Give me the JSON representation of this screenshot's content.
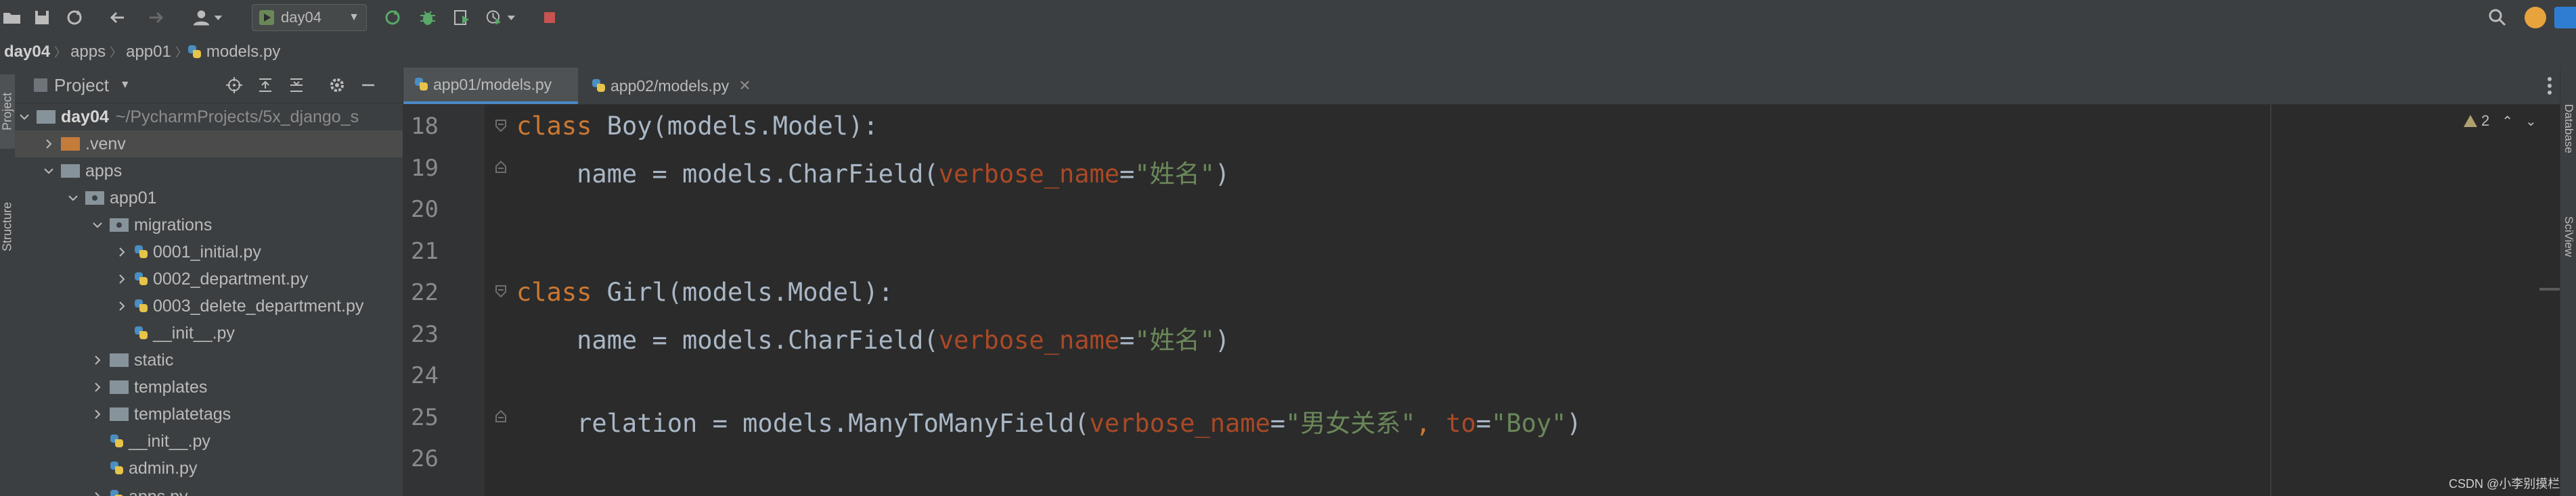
{
  "toolbar": {
    "run_config_label": "day04"
  },
  "breadcrumb": {
    "items": [
      "day04",
      "apps",
      "app01",
      "models.py"
    ]
  },
  "left_strip": {
    "project_tab": "Project",
    "structure_tab": "Structure"
  },
  "right_strip": {
    "database_tab": "Database",
    "sciview_tab": "SciView"
  },
  "project_panel": {
    "title": "Project",
    "tree": {
      "root_name": "day04",
      "root_path": "~/PycharmProjects/5x_django_s",
      "venv": ".venv",
      "apps": "apps",
      "app01": "app01",
      "migrations": "migrations",
      "m1": "0001_initial.py",
      "m2": "0002_department.py",
      "m3": "0003_delete_department.py",
      "m_init": "__init__.py",
      "static": "static",
      "templates": "templates",
      "templatetags": "templatetags",
      "app_init": "__init__.py",
      "admin": "admin.py",
      "apps_py": "apps.py"
    }
  },
  "editor_tabs": [
    {
      "label": "app01/models.py",
      "active": true
    },
    {
      "label": "app02/models.py",
      "active": false
    }
  ],
  "editor": {
    "line_numbers": [
      "18",
      "19",
      "20",
      "21",
      "22",
      "23",
      "24",
      "25",
      "26"
    ],
    "code": {
      "l18_kw": "class",
      "l18_rest": " Boy(models.Model):",
      "l19_a": "    name = models.CharField(",
      "l19_param": "verbose_name",
      "l19_eq": "=",
      "l19_str": "\"姓名\"",
      "l19_close": ")",
      "l22_kw": "class",
      "l22_rest": " Girl(models.Model):",
      "l23_a": "    name = models.CharField(",
      "l23_param": "verbose_name",
      "l23_eq": "=",
      "l23_str": "\"姓名\"",
      "l23_close": ")",
      "l25_a": "    relation = models.ManyToManyField(",
      "l25_param1": "verbose_name",
      "l25_eq1": "=",
      "l25_str1": "\"男女关系\"",
      "l25_comma": ", ",
      "l25_param2": "to",
      "l25_eq2": "=",
      "l25_str2": "\"Boy\"",
      "l25_close": ")"
    },
    "inspection_count": "2"
  },
  "watermark": "CSDN @小李别摸栏",
  "colors": {
    "keyword": "#cc7832",
    "param": "#aa4926",
    "string": "#6a8759",
    "default": "#a9b7c6"
  }
}
